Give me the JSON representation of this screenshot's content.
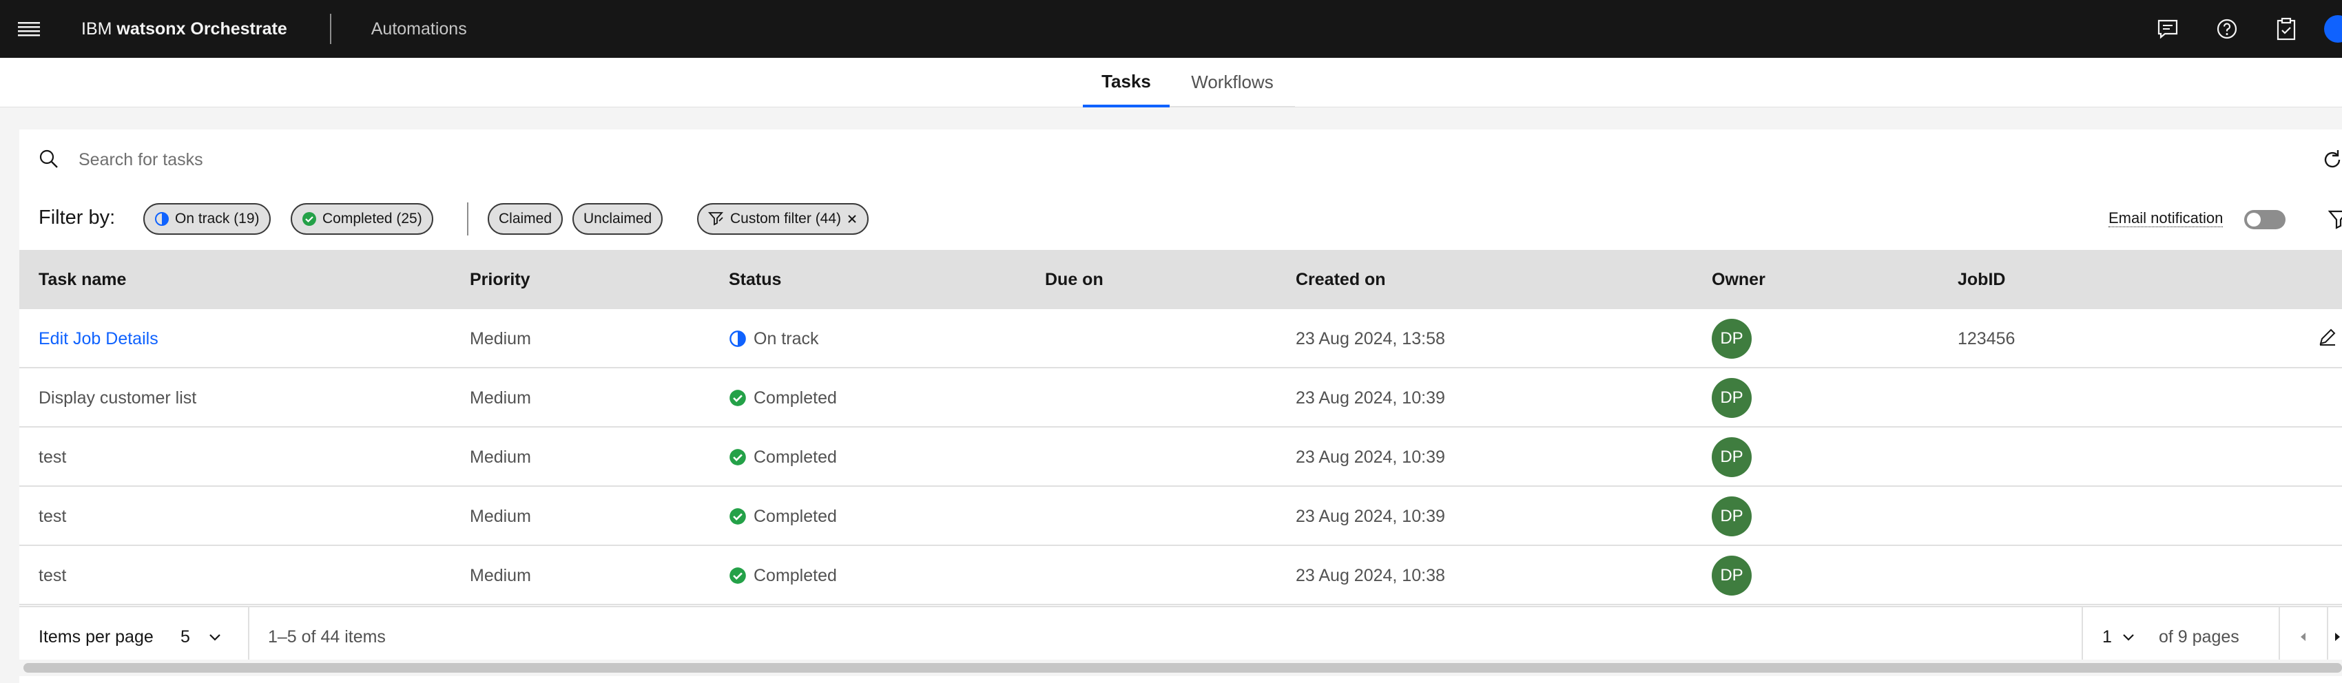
{
  "header": {
    "brand_prefix": "IBM",
    "brand_name": "watsonx Orchestrate",
    "app_name": "Automations",
    "icons": [
      "menu-icon",
      "chat-icon",
      "help-icon",
      "clipboard-check-icon",
      "user-avatar"
    ]
  },
  "tabs": [
    {
      "label": "Tasks",
      "active": true
    },
    {
      "label": "Workflows",
      "active": false
    }
  ],
  "search": {
    "placeholder": "Search for tasks",
    "value": ""
  },
  "filters": {
    "label": "Filter by:",
    "chips": {
      "on_track": "On track (19)",
      "completed": "Completed (25)",
      "claimed": "Claimed",
      "unclaimed": "Unclaimed",
      "custom": "Custom filter (44)"
    },
    "email_notification": "Email notification",
    "email_notification_on": false
  },
  "table": {
    "columns": {
      "task_name": "Task name",
      "priority": "Priority",
      "status": "Status",
      "due_on": "Due on",
      "created_on": "Created on",
      "owner": "Owner",
      "job_id": "JobID"
    },
    "rows": [
      {
        "task_name": "Edit Job Details",
        "priority": "Medium",
        "status": "On track",
        "due_on": "",
        "created_on": "23 Aug 2024, 13:58",
        "owner": "DP",
        "job_id": "123456"
      },
      {
        "task_name": "Display customer list",
        "priority": "Medium",
        "status": "Completed",
        "due_on": "",
        "created_on": "23 Aug 2024, 10:39",
        "owner": "DP",
        "job_id": ""
      },
      {
        "task_name": "test",
        "priority": "Medium",
        "status": "Completed",
        "due_on": "",
        "created_on": "23 Aug 2024, 10:39",
        "owner": "DP",
        "job_id": ""
      },
      {
        "task_name": "test",
        "priority": "Medium",
        "status": "Completed",
        "due_on": "",
        "created_on": "23 Aug 2024, 10:39",
        "owner": "DP",
        "job_id": ""
      },
      {
        "task_name": "test",
        "priority": "Medium",
        "status": "Completed",
        "due_on": "",
        "created_on": "23 Aug 2024, 10:38",
        "owner": "DP",
        "job_id": ""
      }
    ]
  },
  "pagination": {
    "items_per_page_label": "Items per page",
    "items_per_page": "5",
    "range_text": "1–5 of 44 items",
    "current_page": "1",
    "pages_text": "of 9 pages"
  },
  "colors": {
    "accent": "#0f62fe",
    "success": "#24a148",
    "owner_badge": "#3f7d3f",
    "header_bg": "#161616"
  }
}
